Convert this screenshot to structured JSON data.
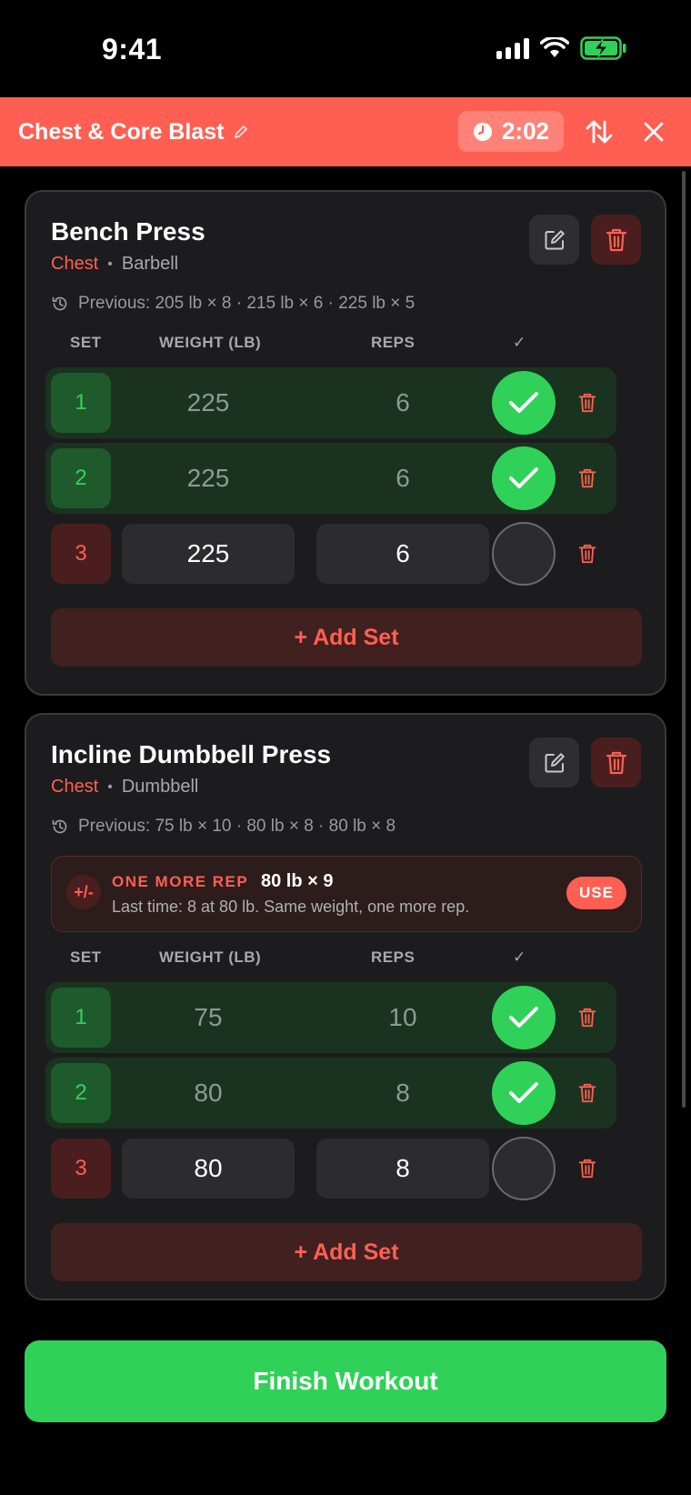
{
  "status_bar": {
    "time": "9:41"
  },
  "header": {
    "workout_title": "Chest & Core Blast",
    "timer": "2:02"
  },
  "exercises": [
    {
      "name": "Bench Press",
      "muscle": "Chest",
      "separator": "•",
      "equipment": "Barbell",
      "previous": "Previous: 205 lb × 8 · 215 lb × 6 · 225 lb × 5",
      "columns": {
        "set": "SET",
        "weight": "WEIGHT (LB)",
        "reps": "REPS",
        "check": "✓"
      },
      "sets": [
        {
          "number": "1",
          "weight": "225",
          "reps": "6",
          "completed": true
        },
        {
          "number": "2",
          "weight": "225",
          "reps": "6",
          "completed": true
        },
        {
          "number": "3",
          "weight": "225",
          "reps": "6",
          "completed": false
        }
      ],
      "add_set_label": "+ Add Set"
    },
    {
      "name": "Incline Dumbbell Press",
      "muscle": "Chest",
      "separator": "•",
      "equipment": "Dumbbell",
      "previous": "Previous: 75 lb × 10 · 80 lb × 8 · 80 lb × 8",
      "suggestion": {
        "icon_text": "+/-",
        "kicker": "ONE MORE REP",
        "target": "80 lb × 9",
        "note": "Last time: 8 at 80 lb. Same weight, one more rep.",
        "use_label": "USE"
      },
      "columns": {
        "set": "SET",
        "weight": "WEIGHT (LB)",
        "reps": "REPS",
        "check": "✓"
      },
      "sets": [
        {
          "number": "1",
          "weight": "75",
          "reps": "10",
          "completed": true
        },
        {
          "number": "2",
          "weight": "80",
          "reps": "8",
          "completed": true
        },
        {
          "number": "3",
          "weight": "80",
          "reps": "8",
          "completed": false
        }
      ],
      "add_set_label": "+ Add Set"
    }
  ],
  "finish_label": "Finish Workout",
  "colors": {
    "accent": "#ff5f52",
    "success": "#30d158",
    "card": "#1c1c1e",
    "background": "#000000"
  },
  "icons": [
    "signal-icon",
    "wifi-icon",
    "battery-charging-icon",
    "pencil-icon",
    "clock-icon",
    "reorder-icon",
    "close-icon",
    "edit-icon",
    "trash-icon",
    "history-icon",
    "checkmark-icon"
  ]
}
